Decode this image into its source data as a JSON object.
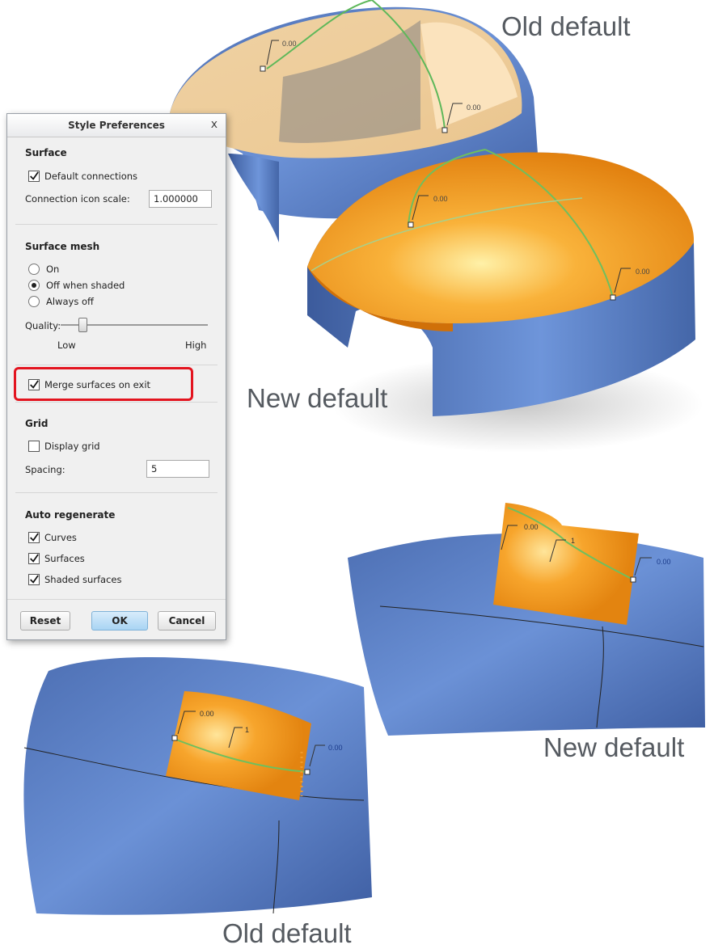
{
  "captions": {
    "top_right": "Old default",
    "middle": "New default",
    "right": "New default",
    "bottom": "Old default"
  },
  "annotations": {
    "zero": "0.00",
    "one": "1"
  },
  "dialog": {
    "title": "Style Preferences",
    "close_symbol": "x",
    "surface": {
      "header": "Surface",
      "default_connections": {
        "label": "Default connections",
        "checked": true
      },
      "icon_scale_label": "Connection icon scale:",
      "icon_scale_value": "1.000000"
    },
    "surface_mesh": {
      "header": "Surface mesh",
      "options": [
        "On",
        "Off when shaded",
        "Always off"
      ],
      "selected": "Off when shaded",
      "quality_label": "Quality:",
      "quality_low": "Low",
      "quality_high": "High",
      "quality_level": 0.15
    },
    "merge": {
      "label": "Merge surfaces on exit",
      "checked": true
    },
    "grid": {
      "header": "Grid",
      "display_grid": {
        "label": "Display grid",
        "checked": false
      },
      "spacing_label": "Spacing:",
      "spacing_value": "5"
    },
    "auto_regenerate": {
      "header": "Auto regenerate",
      "curves": {
        "label": "Curves",
        "checked": true
      },
      "surfaces": {
        "label": "Surfaces",
        "checked": true
      },
      "shaded_surfaces": {
        "label": "Shaded surfaces",
        "checked": true
      }
    },
    "buttons": {
      "reset": "Reset",
      "ok": "OK",
      "cancel": "Cancel"
    }
  },
  "colors": {
    "surface_blue": "#5a7fc0",
    "surface_orange": "#f39a1e",
    "highlight_red": "#e3141f"
  }
}
